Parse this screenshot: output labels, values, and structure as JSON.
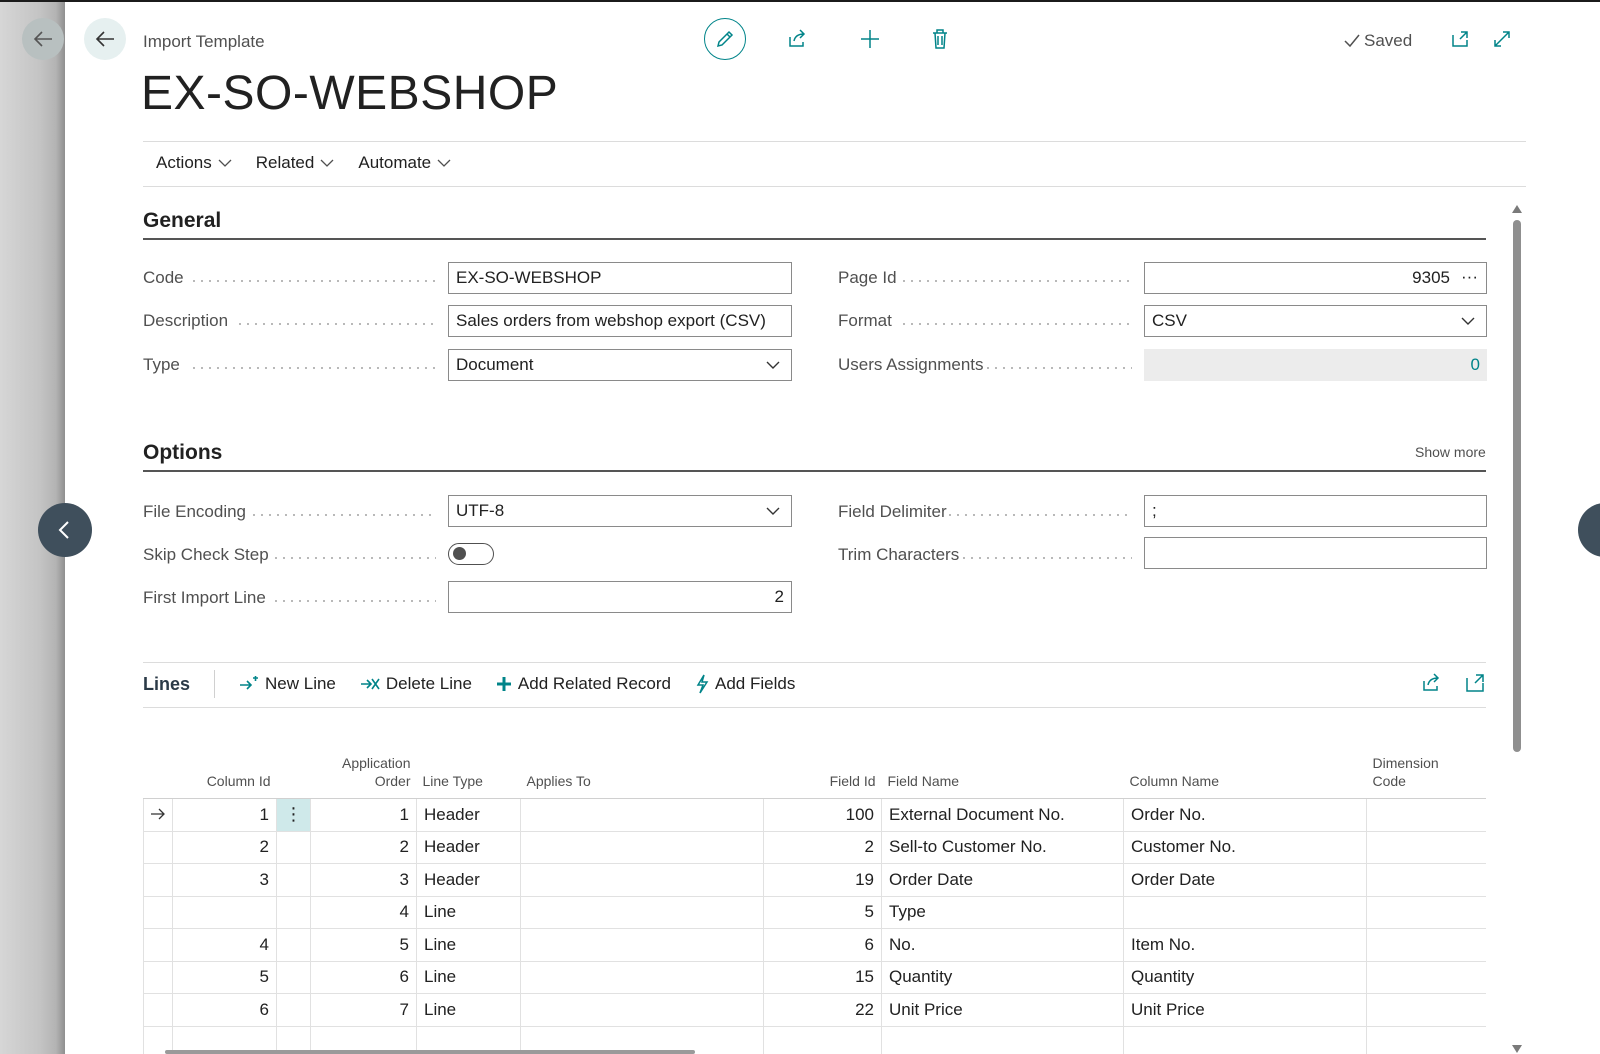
{
  "header": {
    "breadcrumb": "Import Template",
    "title": "EX-SO-WEBSHOP",
    "status": "Saved"
  },
  "menu": [
    {
      "label": "Actions"
    },
    {
      "label": "Related"
    },
    {
      "label": "Automate"
    }
  ],
  "general": {
    "title": "General",
    "code_label": "Code",
    "code_value": "EX-SO-WEBSHOP",
    "description_label": "Description",
    "description_value": "Sales orders from webshop export (CSV)",
    "type_label": "Type",
    "type_value": "Document",
    "page_id_label": "Page Id",
    "page_id_value": "9305",
    "page_id_lookup": "···",
    "format_label": "Format",
    "format_value": "CSV",
    "users_label": "Users Assignments",
    "users_value": "0"
  },
  "options": {
    "title": "Options",
    "show_more": "Show more",
    "encoding_label": "File Encoding",
    "encoding_value": "UTF-8",
    "skip_label": "Skip Check Step",
    "skip_value": false,
    "first_line_label": "First Import Line",
    "first_line_value": "2",
    "delimiter_label": "Field Delimiter",
    "delimiter_value": ";",
    "trim_label": "Trim Characters",
    "trim_value": ""
  },
  "lines": {
    "title": "Lines",
    "actions": [
      {
        "label": "New Line"
      },
      {
        "label": "Delete Line"
      },
      {
        "label": "Add Related Record"
      },
      {
        "label": "Add Fields"
      }
    ],
    "columns": {
      "column_id": "Column Id",
      "app_order_1": "Application",
      "app_order_2": "Order",
      "line_type": "Line Type",
      "applies_to": "Applies To",
      "field_id": "Field Id",
      "field_name": "Field Name",
      "column_name": "Column Name",
      "dim_code_1": "Dimension",
      "dim_code_2": "Code"
    },
    "rows": [
      {
        "column_id": "1",
        "order": "1",
        "line_type": "Header",
        "applies_to": "",
        "field_id": "100",
        "field_name": "External Document No.",
        "column_name": "Order No.",
        "dim": ""
      },
      {
        "column_id": "2",
        "order": "2",
        "line_type": "Header",
        "applies_to": "",
        "field_id": "2",
        "field_name": "Sell-to Customer No.",
        "column_name": "Customer No.",
        "dim": ""
      },
      {
        "column_id": "3",
        "order": "3",
        "line_type": "Header",
        "applies_to": "",
        "field_id": "19",
        "field_name": "Order Date",
        "column_name": "Order Date",
        "dim": ""
      },
      {
        "column_id": "",
        "order": "4",
        "line_type": "Line",
        "applies_to": "",
        "field_id": "5",
        "field_name": "Type",
        "column_name": "",
        "dim": ""
      },
      {
        "column_id": "4",
        "order": "5",
        "line_type": "Line",
        "applies_to": "",
        "field_id": "6",
        "field_name": "No.",
        "column_name": "Item No.",
        "dim": ""
      },
      {
        "column_id": "5",
        "order": "6",
        "line_type": "Line",
        "applies_to": "",
        "field_id": "15",
        "field_name": "Quantity",
        "column_name": "Quantity",
        "dim": ""
      },
      {
        "column_id": "6",
        "order": "7",
        "line_type": "Line",
        "applies_to": "",
        "field_id": "22",
        "field_name": "Unit Price",
        "column_name": "Unit Price",
        "dim": ""
      },
      {
        "column_id": "",
        "order": "",
        "line_type": "",
        "applies_to": "",
        "field_id": "",
        "field_name": "",
        "column_name": "",
        "dim": ""
      }
    ]
  },
  "colors": {
    "accent": "#008489",
    "nav_circle": "#3f4f5c"
  }
}
